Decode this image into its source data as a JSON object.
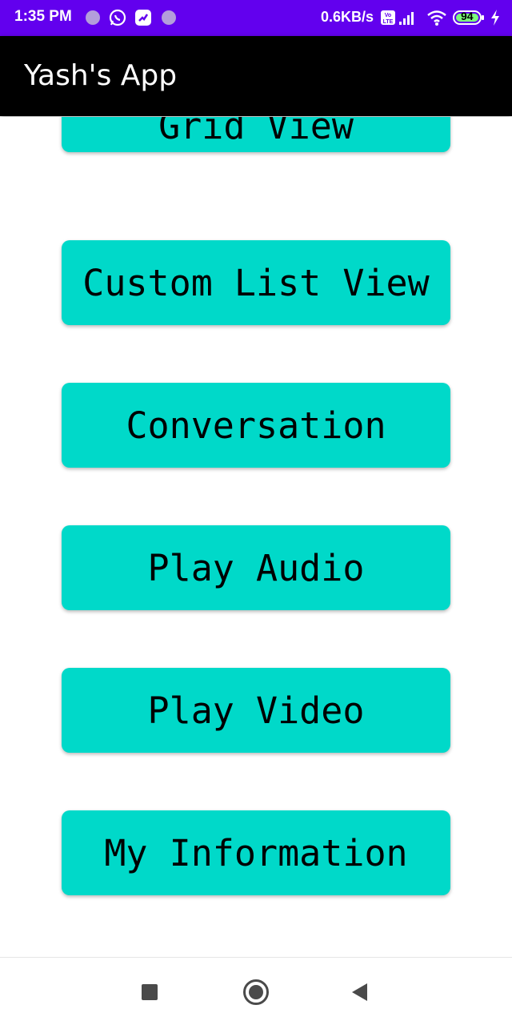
{
  "status_bar": {
    "time": "1:35 PM",
    "network_speed": "0.6KB/s",
    "battery": "94",
    "icons": [
      "notification-dot-icon",
      "whatsapp-icon",
      "app-notification-icon",
      "notification-dot-icon",
      "volte-icon",
      "signal-icon",
      "wifi-icon",
      "battery-icon",
      "charging-icon"
    ],
    "background": "#6200ee"
  },
  "app_bar": {
    "title": "Yash's App",
    "background": "#000000"
  },
  "menu": {
    "button_color": "#00d9c9",
    "items": [
      {
        "label": "Grid View",
        "partially_visible": true
      },
      {
        "label": "Custom List View"
      },
      {
        "label": "Conversation"
      },
      {
        "label": "Play Audio"
      },
      {
        "label": "Play Video"
      },
      {
        "label": "My Information"
      }
    ]
  },
  "nav_bar": {
    "icons": [
      "recents-square-icon",
      "home-circle-icon",
      "back-triangle-icon"
    ]
  }
}
